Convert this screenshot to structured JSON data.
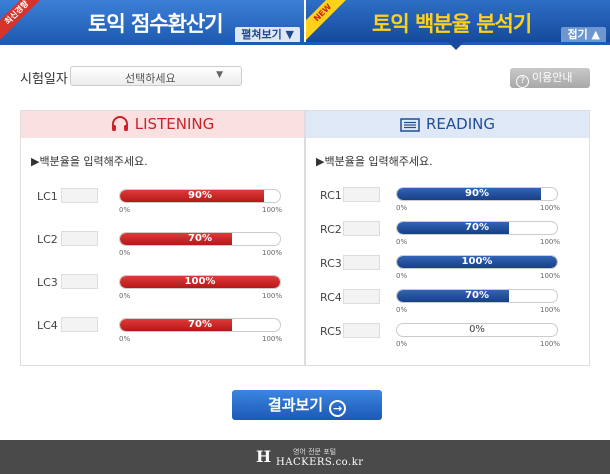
{
  "header": {
    "left_corner_badge": "최신경향",
    "left_title": "토익 점수환산기",
    "left_button": "펼쳐보기 ▼",
    "right_corner_badge": "NEW",
    "right_title": "토익 백분율 분석기",
    "right_button": "접기 ▲"
  },
  "date_row": {
    "label": "시험일자",
    "select_value": "선택하세요",
    "select_arrow": "▼",
    "help_icon": "?",
    "help_button": "이용안내"
  },
  "listening": {
    "title": "LISTENING",
    "icon": "headphones-icon",
    "accent": "#c9232a",
    "instruction": "▶백분율을 입력해주세요.",
    "rows": [
      {
        "label": "LC1",
        "percent": 90,
        "text": "90%",
        "min": "0%",
        "max": "100%"
      },
      {
        "label": "LC2",
        "percent": 70,
        "text": "70%",
        "min": "0%",
        "max": "100%"
      },
      {
        "label": "LC3",
        "percent": 100,
        "text": "100%",
        "min": "0%",
        "max": "100%"
      },
      {
        "label": "LC4",
        "percent": 70,
        "text": "70%",
        "min": "0%",
        "max": "100%"
      }
    ]
  },
  "reading": {
    "title": "READING",
    "icon": "book-icon",
    "accent": "#1f4e96",
    "instruction": "▶백분율을 입력해주세요.",
    "rows": [
      {
        "label": "RC1",
        "percent": 90,
        "text": "90%",
        "min": "0%",
        "max": "100%"
      },
      {
        "label": "RC2",
        "percent": 70,
        "text": "70%",
        "min": "0%",
        "max": "100%"
      },
      {
        "label": "RC3",
        "percent": 100,
        "text": "100%",
        "min": "0%",
        "max": "100%"
      },
      {
        "label": "RC4",
        "percent": 70,
        "text": "70%",
        "min": "0%",
        "max": "100%"
      },
      {
        "label": "RC5",
        "percent": 0,
        "text": "0%",
        "min": "0%",
        "max": "100%"
      }
    ]
  },
  "result_button": {
    "label": "결과보기",
    "icon": "arrow-circle-right-icon",
    "arrow": "→"
  },
  "footer": {
    "logo_mark": "H",
    "logo_sub": "영어 전문 포털",
    "logo_main": "HACKERS.co.kr"
  }
}
